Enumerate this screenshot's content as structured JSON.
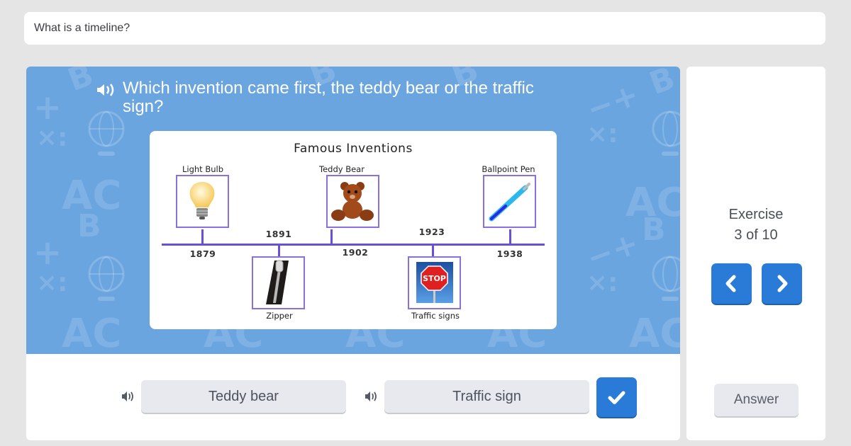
{
  "header": {
    "title": "What is a timeline?"
  },
  "question": {
    "text": "Which invention came first, the teddy bear or the traffic sign?",
    "audio_icon": "speaker-icon"
  },
  "timeline": {
    "title": "Famous Inventions",
    "line_color": "#6a4fd8",
    "items": [
      {
        "name": "Light Bulb",
        "year": "1879",
        "position": "above",
        "image": "light-bulb-image"
      },
      {
        "name": "Zipper",
        "year": "1891",
        "position": "below",
        "image": "zipper-image"
      },
      {
        "name": "Teddy Bear",
        "year": "1902",
        "position": "above",
        "image": "teddy-bear-image"
      },
      {
        "name": "Traffic signs",
        "year": "1923",
        "position": "below",
        "image": "stop-sign-image",
        "sign_text": "STOP"
      },
      {
        "name": "Ballpoint Pen",
        "year": "1938",
        "position": "above",
        "image": "ballpoint-pen-image"
      }
    ]
  },
  "choices": [
    {
      "label": "Teddy bear",
      "audio_icon": "speaker-icon"
    },
    {
      "label": "Traffic sign",
      "audio_icon": "speaker-icon"
    }
  ],
  "check_button": {
    "icon": "check-icon"
  },
  "sidebar": {
    "exercise_label": "Exercise",
    "exercise_progress": "3 of 10",
    "current": 3,
    "total": 10,
    "prev_icon": "chevron-left-icon",
    "next_icon": "chevron-right-icon",
    "answer_label": "Answer"
  },
  "colors": {
    "accent": "#2a7bd8",
    "stage_bg": "#6aa5e0",
    "button_bg": "#e8e9ee",
    "page_bg": "#e5e5e5"
  }
}
